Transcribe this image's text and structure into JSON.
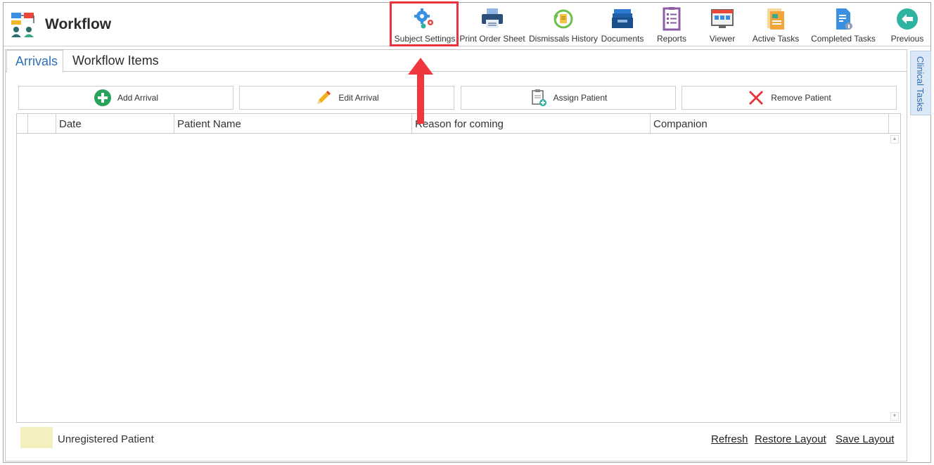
{
  "app": {
    "title": "Workflow"
  },
  "toolbar": [
    {
      "label": "Subject Settings",
      "icon": "gear-icon"
    },
    {
      "label": "Print Order Sheet",
      "icon": "printer-icon"
    },
    {
      "label": "Dismissals History",
      "icon": "history-icon"
    },
    {
      "label": "Documents",
      "icon": "inbox-icon"
    },
    {
      "label": "Reports",
      "icon": "report-icon"
    },
    {
      "label": "Viewer",
      "icon": "viewer-icon"
    },
    {
      "label": "Active Tasks",
      "icon": "active-tasks-icon"
    },
    {
      "label": "Completed Tasks",
      "icon": "completed-tasks-icon"
    },
    {
      "label": "Previous",
      "icon": "back-arrow-icon"
    }
  ],
  "side_tab": {
    "label": "Clinical Tasks"
  },
  "tabs": [
    {
      "label": "Arrivals",
      "active": true
    },
    {
      "label": "Workflow Items",
      "active": false
    }
  ],
  "actions": [
    {
      "label": "Add Arrival",
      "icon": "plus-circle-icon"
    },
    {
      "label": "Edit Arrival",
      "icon": "pencil-icon"
    },
    {
      "label": "Assign Patient",
      "icon": "clipboard-add-icon"
    },
    {
      "label": "Remove Patient",
      "icon": "x-icon"
    }
  ],
  "grid": {
    "columns": [
      "Date",
      "Patient Name",
      "Reason for coming",
      "Companion"
    ],
    "rows": []
  },
  "legend": {
    "label": "Unregistered Patient",
    "color": "#f3f0bd"
  },
  "footer_links": [
    "Refresh",
    "Restore Layout",
    "Save Layout"
  ],
  "colors": {
    "accent": "#2f6fb5",
    "highlight": "#e8333a"
  }
}
